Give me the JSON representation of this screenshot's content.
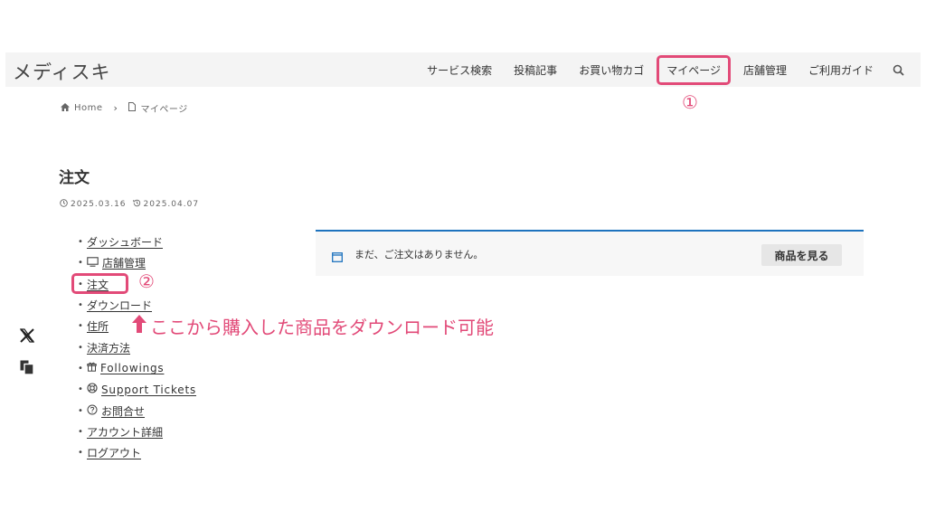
{
  "header": {
    "logo": "メディスキ",
    "nav": [
      "サービス検索",
      "投稿記事",
      "お買い物カゴ",
      "マイページ",
      "店舗管理",
      "ご利用ガイド"
    ]
  },
  "annotations": {
    "step1": "①",
    "step2": "②",
    "callout": "ここから購入した商品をダウンロード可能",
    "accent_color": "#e24a78"
  },
  "breadcrumb": {
    "home": "Home",
    "current": "マイページ"
  },
  "page": {
    "title": "注文",
    "published": "2025.03.16",
    "updated": "2025.04.07"
  },
  "menu": [
    {
      "label": "ダッシュボード",
      "icon": ""
    },
    {
      "label": "店舗管理",
      "icon": "monitor-icon"
    },
    {
      "label": "注文",
      "icon": ""
    },
    {
      "label": "ダウンロード",
      "icon": ""
    },
    {
      "label": "住所",
      "icon": ""
    },
    {
      "label": "決済方法",
      "icon": ""
    },
    {
      "label": "Followings",
      "icon": "gift-icon"
    },
    {
      "label": "Support Tickets",
      "icon": "lifebuoy-icon"
    },
    {
      "label": "お問合せ",
      "icon": "question-icon"
    },
    {
      "label": "アカウント詳細",
      "icon": ""
    },
    {
      "label": "ログアウト",
      "icon": ""
    }
  ],
  "notice": {
    "message": "まだ、ご注文はありません。",
    "button": "商品を見る",
    "border_color": "#1e73be"
  }
}
